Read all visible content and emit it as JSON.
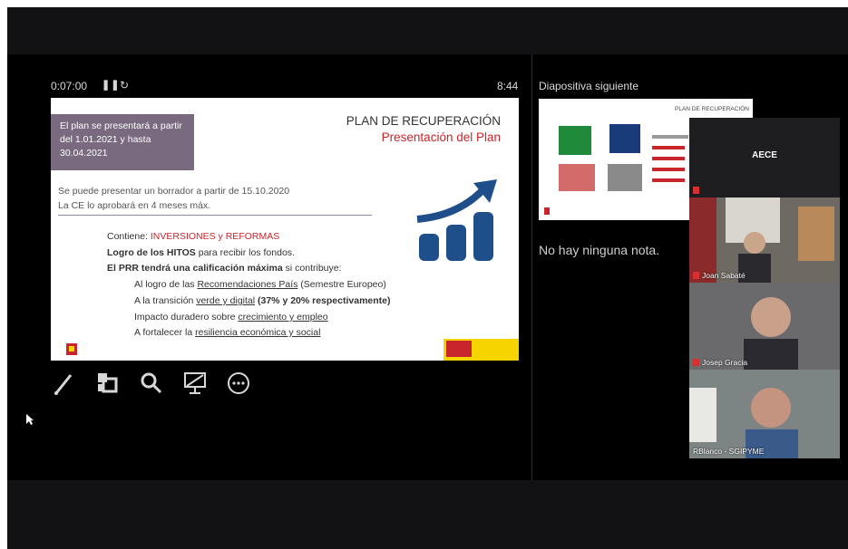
{
  "header": {
    "timer": "0:07:00",
    "clock": "8:44",
    "next_slide_label": "Diapositiva siguiente"
  },
  "slide": {
    "box_text": "El plan se presentará a partir del 1.01.2021 y hasta 30.04.2021",
    "title": "PLAN DE RECUPERACIÓN",
    "subtitle": "Presentación del Plan",
    "line1": "Se puede presentar un borrador a partir de 15.10.2020",
    "line2": "La CE lo aprobará en 4 meses máx.",
    "contiene_prefix": "Contiene: ",
    "contiene_red": "INVERSIONES y REFORMAS",
    "logro_bold": "Logro de los HITOS",
    "logro_rest": " para recibir los fondos.",
    "prr_a": "El PRR tendrá una ",
    "prr_b": "calificación máxima",
    "prr_c": " si contribuye:",
    "i1_a": "Al logro de las ",
    "i1_b": "Recomendaciones País",
    "i1_c": " (Semestre Europeo)",
    "i2_a": "A la transición ",
    "i2_b": "verde y digital",
    "i2_c": " (37% y 20% respectivamente)",
    "i3_a": "Impacto duradero sobre ",
    "i3_b": "crecimiento y empleo",
    "i4_a": "A fortalecer la ",
    "i4_b": "resiliencia económica y social"
  },
  "next_slide": {
    "title": "PLAN DE RECUPERACIÓN"
  },
  "notes": {
    "text": "No hay ninguna nota."
  },
  "participants": [
    {
      "label": "AECE"
    },
    {
      "label": "Joan Sabaté"
    },
    {
      "label": "Josep Gracia"
    },
    {
      "label": "RBlanco - SGIPYME"
    }
  ],
  "colors": {
    "accent_red": "#c8262c",
    "chart_blue": "#1f4f8a",
    "slide_purple": "#7a6a80"
  },
  "icons": [
    "pause-icon",
    "reset-icon",
    "pen-icon",
    "slide-grid-icon",
    "zoom-icon",
    "screen-icon",
    "more-icon"
  ]
}
